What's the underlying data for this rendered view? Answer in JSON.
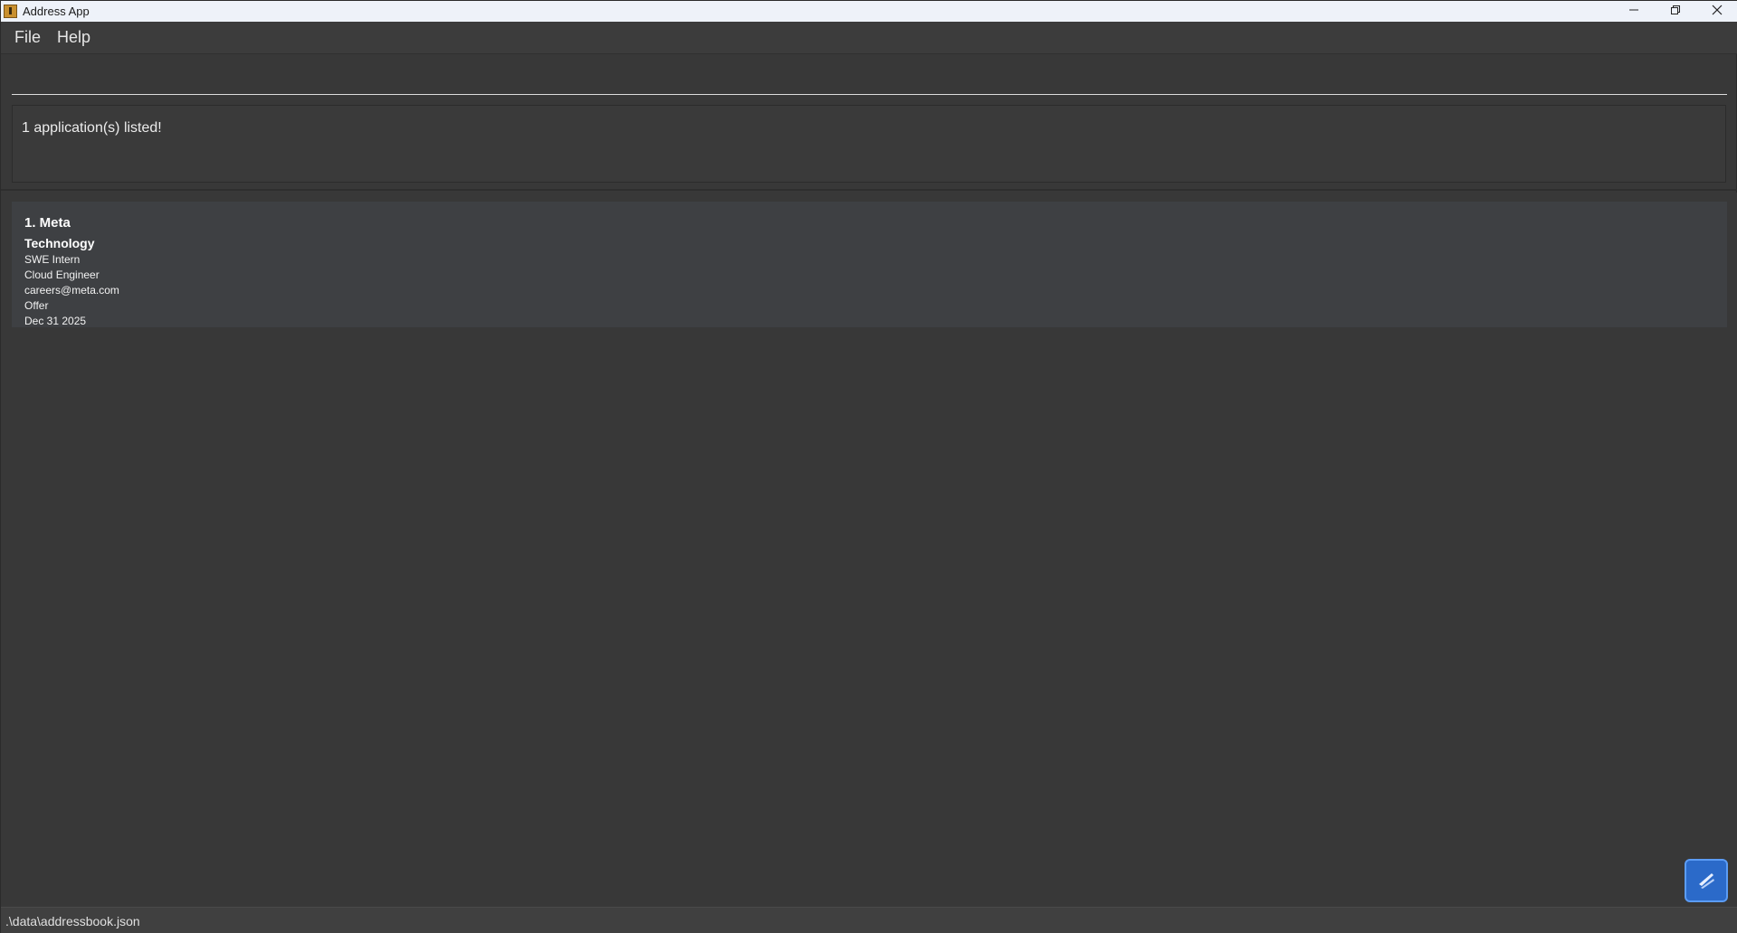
{
  "window": {
    "title": "Address App",
    "icon": "app-icon",
    "controls": [
      "minimize-icon",
      "restore-icon",
      "close-icon"
    ]
  },
  "menu": {
    "items": [
      {
        "label": "File"
      },
      {
        "label": "Help"
      }
    ]
  },
  "command": {
    "value": "",
    "placeholder": ""
  },
  "result": {
    "message": "1 application(s) listed!"
  },
  "applications": [
    {
      "title": "1. Meta",
      "industry": "Technology",
      "role": "SWE Intern",
      "position": "Cloud Engineer",
      "email": "careers@meta.com",
      "status": "Offer",
      "deadline": "Dec 31 2025"
    }
  ],
  "status_bar": {
    "path": ".\\data\\addressbook.json"
  },
  "colors": {
    "background": "#383838",
    "card": "#3e4043",
    "accent": "#2b6ac9"
  }
}
